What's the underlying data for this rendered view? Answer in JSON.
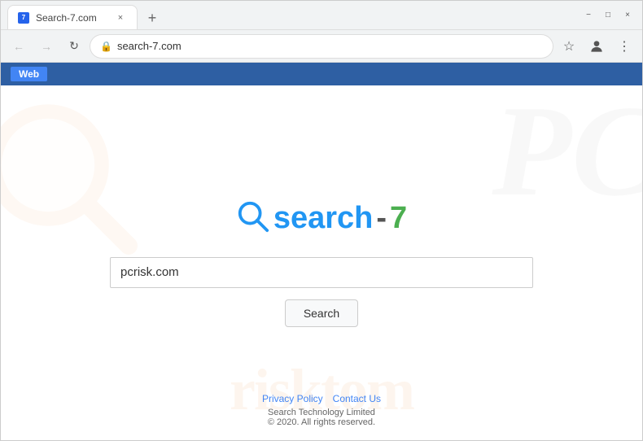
{
  "browser": {
    "tab": {
      "favicon": "7",
      "title": "Search-7.com",
      "close_label": "×"
    },
    "new_tab_label": "+",
    "window_controls": {
      "minimize": "−",
      "maximize": "□",
      "close": "×"
    },
    "nav": {
      "back_label": "←",
      "forward_label": "→",
      "reload_label": "↻",
      "address": "search-7.com"
    },
    "web_label": "Web"
  },
  "page": {
    "logo": {
      "search_text": "search",
      "dash_text": "-",
      "number_text": "7"
    },
    "search_input_value": "pcrisk.com",
    "search_button_label": "Search",
    "footer": {
      "privacy_label": "Privacy Policy",
      "contact_label": "Contact Us",
      "copyright_line1": "Search Technology Limited",
      "copyright_line2": "© 2020. All rights reserved."
    },
    "watermark": {
      "risk_text": "risktom"
    }
  }
}
